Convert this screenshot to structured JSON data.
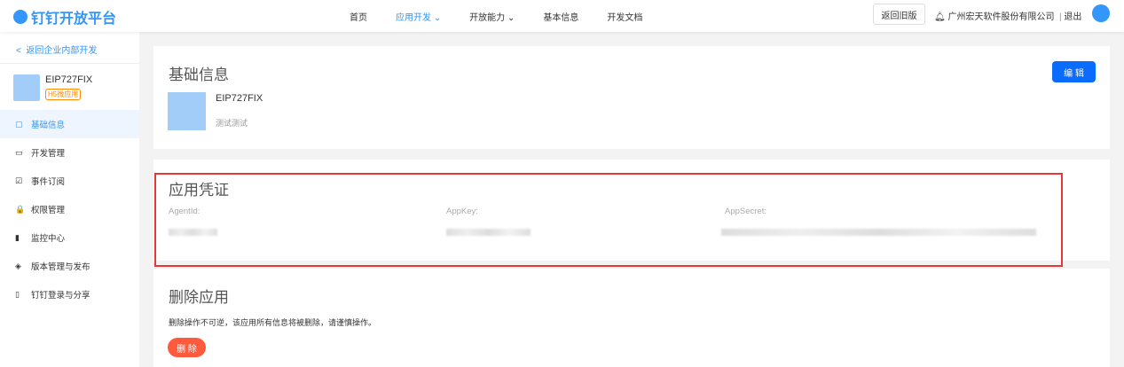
{
  "header": {
    "logo": "钉钉开放平台",
    "nav": [
      "首页",
      "应用开发 ⌄",
      "开放能力 ⌄",
      "基本信息",
      "开发文档"
    ],
    "old_version": "返回旧版",
    "company": "广州宏天软件股份有限公司",
    "logout": "退出"
  },
  "sidebar": {
    "back": "返回企业内部开发",
    "app_name": "EIP727FIX",
    "app_tag": "H5微应用",
    "items": [
      {
        "icon": "▢",
        "label": "基础信息"
      },
      {
        "icon": "▭",
        "label": "开发管理"
      },
      {
        "icon": "☑",
        "label": "事件订阅"
      },
      {
        "icon": "🔒",
        "label": "权限管理"
      },
      {
        "icon": "▮",
        "label": "监控中心"
      },
      {
        "icon": "◈",
        "label": "版本管理与发布"
      },
      {
        "icon": "▯",
        "label": "钉钉登录与分享"
      }
    ]
  },
  "basic": {
    "title": "基础信息",
    "edit": "编 辑",
    "app_name": "EIP727FIX",
    "desc": "测试测试"
  },
  "cred": {
    "title": "应用凭证",
    "agentid_label": "AgentId:",
    "appkey_label": "AppKey:",
    "appsecret_label": "AppSecret:"
  },
  "delete": {
    "title": "删除应用",
    "warning": "删除操作不可逆，该应用所有信息将被删除，请谨慎操作。",
    "button": "删 除"
  }
}
